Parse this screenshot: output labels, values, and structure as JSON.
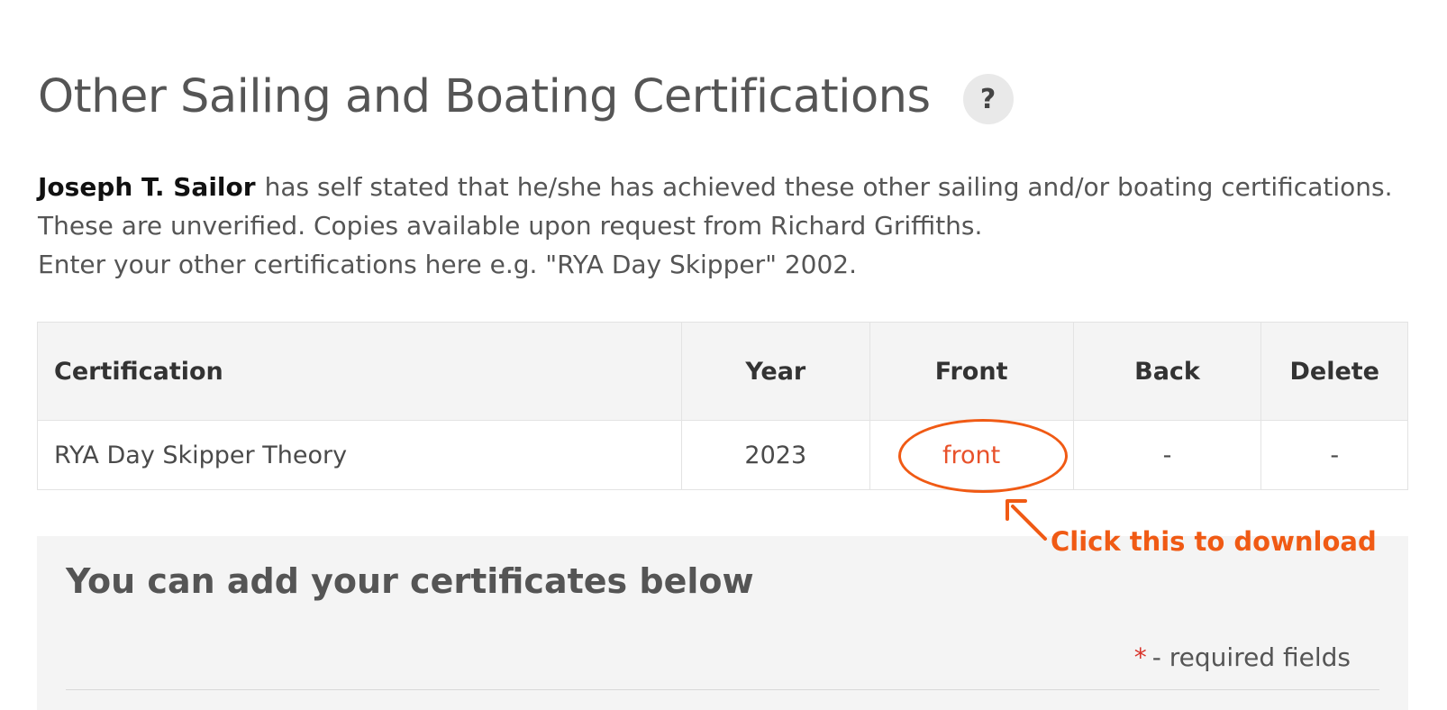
{
  "page": {
    "title": "Other Sailing and Boating Certifications",
    "help_label": "?"
  },
  "intro": {
    "user_name": "Joseph T. Sailor",
    "line1_rest": "has self stated that he/she has achieved these other sailing and/or boating certifications.",
    "line2": "These are unverified. Copies available upon request from Richard Griffiths.",
    "line3": "Enter your other certifications here e.g. \"RYA Day Skipper\" 2002."
  },
  "table": {
    "headers": {
      "certification": "Certification",
      "year": "Year",
      "front": "Front",
      "back": "Back",
      "delete": "Delete"
    },
    "rows": [
      {
        "certification": "RYA Day Skipper Theory",
        "year": "2023",
        "front": "front",
        "back": "-",
        "delete": "-"
      }
    ]
  },
  "annotation": {
    "text": "Click this to download",
    "color": "#f05a14"
  },
  "add_section": {
    "title": "You can add your certificates below",
    "required_star": "*",
    "required_text": "- required fields"
  }
}
